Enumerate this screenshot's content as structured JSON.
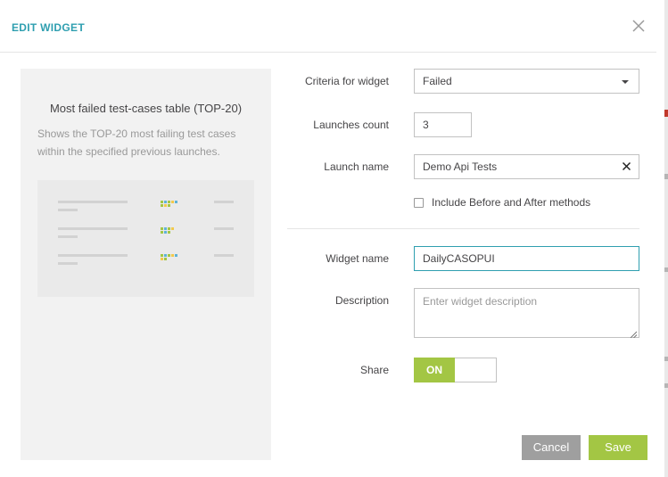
{
  "dialog": {
    "title": "EDIT WIDGET"
  },
  "preview": {
    "title": "Most failed test-cases table (TOP-20)",
    "description": "Shows the TOP-20 most failing test cases within the specified previous launches."
  },
  "form": {
    "criteria": {
      "label": "Criteria for widget",
      "value": "Failed"
    },
    "launches_count": {
      "label": "Launches count",
      "value": "3"
    },
    "launch_name": {
      "label": "Launch name",
      "value": "Demo Api Tests"
    },
    "include_methods": {
      "label": "Include Before and After methods",
      "checked": false
    },
    "widget_name": {
      "label": "Widget name",
      "value": "DailyCASOPUI"
    },
    "description": {
      "label": "Description",
      "placeholder": "Enter widget description",
      "value": ""
    },
    "share": {
      "label": "Share",
      "state": "ON"
    }
  },
  "buttons": {
    "cancel": "Cancel",
    "save": "Save"
  },
  "colors": {
    "accent": "#2f9fb0",
    "primary_button": "#a3c644",
    "secondary_button": "#9f9f9f",
    "thumbnail_green": "#a3c644",
    "thumbnail_blue": "#5fb4d6",
    "thumbnail_yellow": "#f2c94c"
  },
  "icons": {
    "close": "close-icon",
    "dropdown": "chevron-down-icon",
    "clear": "clear-icon"
  }
}
